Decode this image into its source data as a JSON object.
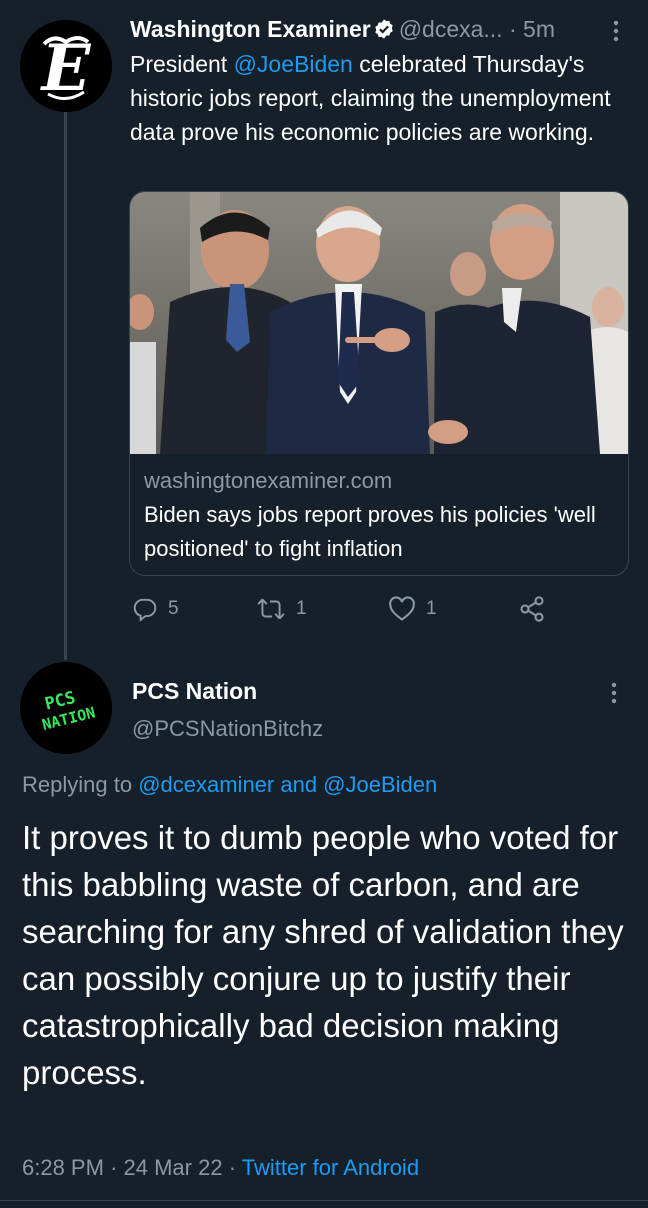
{
  "tweet": {
    "author_name": "Washington Examiner",
    "author_handle": "@dcexa...",
    "separator": "·",
    "time_ago": "5m",
    "text_prefix": "President ",
    "mention": "@JoeBiden",
    "text_suffix": " celebrated Thursday's historic jobs report, claiming the unemployment data prove his economic policies are working.",
    "card": {
      "domain": "washingtonexaminer.com",
      "title": "Biden says jobs report proves his policies 'well positioned' to fight inflation"
    },
    "actions": {
      "replies": "5",
      "retweets": "1",
      "likes": "1"
    }
  },
  "reply": {
    "author_name": "PCS Nation",
    "author_handle": "@PCSNationBitchz",
    "avatar_text_line1": "PCS",
    "avatar_text_line2": "NATION",
    "replying_prefix": "Replying to ",
    "replying_to": "@dcexaminer and @JoeBiden",
    "text": "It proves it to dumb people who voted for this babbling waste of carbon, and are searching for any shred of validation they can possibly conjure up to justify their catastrophically bad decision making process.",
    "time": "6:28 PM",
    "date": "24 Mar 22",
    "source": "Twitter for Android"
  },
  "colors": {
    "background": "#15202b",
    "accent": "#1d9bf0",
    "muted": "#8b98a5",
    "border": "#38444d",
    "avatar_green": "#39e75f"
  }
}
